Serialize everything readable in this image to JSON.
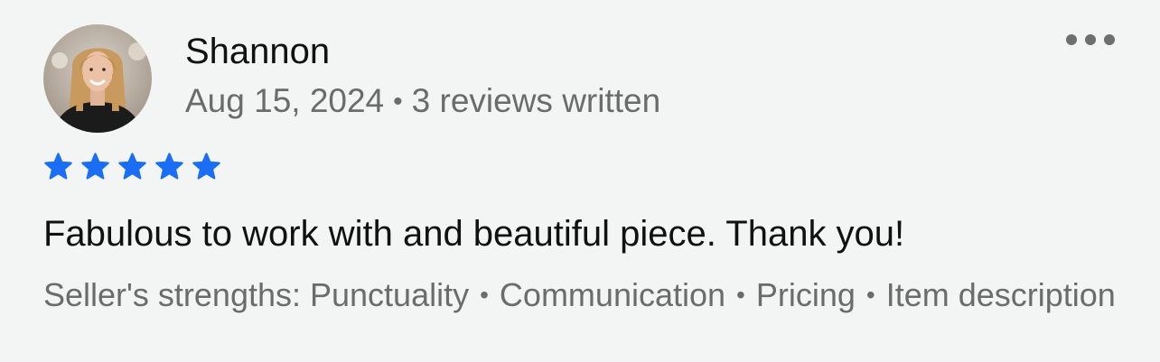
{
  "review": {
    "reviewer_name": "Shannon",
    "date": "Aug 15, 2024",
    "meta_separator": "•",
    "reviews_written": "3 reviews written",
    "rating": 5,
    "rating_max": 5,
    "star_color": "#1a6ef5",
    "text": "Fabulous to work with and beautiful piece. Thank you!",
    "strengths_prefix": "Seller's strengths: ",
    "strengths": [
      "Punctuality",
      "Communication",
      "Pricing",
      "Item description"
    ],
    "strength_separator": "•",
    "avatar_icon": "reviewer-avatar-photo",
    "more_icon": "more-options-horizontal-dots"
  }
}
